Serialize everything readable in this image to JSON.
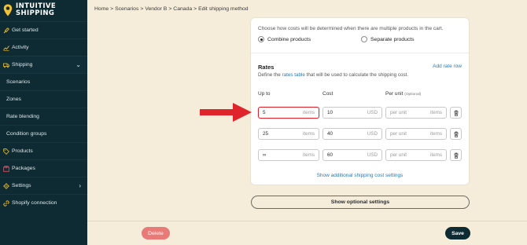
{
  "brand": {
    "line1": "INTUITIVE",
    "line2": "SHIPPING",
    "pin_color": "#f2c230"
  },
  "sidebar": {
    "items": [
      {
        "label": "Get started",
        "icon": "rocket-icon"
      },
      {
        "label": "Activity",
        "icon": "activity-icon"
      },
      {
        "label": "Shipping",
        "icon": "truck-icon",
        "expanded": true
      },
      {
        "label": "Scenarios"
      },
      {
        "label": "Zones"
      },
      {
        "label": "Rate blending"
      },
      {
        "label": "Condition groups"
      },
      {
        "label": "Products",
        "icon": "tag-icon"
      },
      {
        "label": "Packages",
        "icon": "package-icon"
      },
      {
        "label": "Settings",
        "icon": "gear-icon"
      },
      {
        "label": "Shopify connection",
        "icon": "link-icon"
      }
    ]
  },
  "breadcrumb": [
    "Home",
    "Scenarios",
    "Vendor B",
    "Canada",
    "Edit shipping method"
  ],
  "cart": {
    "hint": "Choose how costs will be determined when there are multiple products in the cart.",
    "option_combine": "Combine products",
    "option_separate": "Separate products",
    "selected": "Combine products"
  },
  "rates": {
    "title": "Rates",
    "add_row": "Add rate row",
    "desc_before": "Define the",
    "desc_link": "rates table",
    "desc_after": "that will be used to calculate the shipping cost.",
    "col_upto": "Up to",
    "col_cost": "Cost",
    "col_perunit": "Per unit",
    "col_perunit_note": "(Optional)",
    "rows": [
      {
        "upto": "5",
        "upto_unit": "items",
        "cost": "10",
        "currency": "USD",
        "perunit_placeholder": "per unit",
        "perunit_unit": "items"
      },
      {
        "upto": "25",
        "upto_unit": "items",
        "cost": "40",
        "currency": "USD",
        "perunit_placeholder": "per unit",
        "perunit_unit": "items"
      },
      {
        "upto": "∞",
        "upto_unit": "items",
        "cost": "60",
        "currency": "USD",
        "perunit_placeholder": "per unit",
        "perunit_unit": "items"
      }
    ],
    "show_additional": "Show additional shipping cost settings"
  },
  "buttons": {
    "optional": "Show optional settings",
    "delete": "Delete",
    "save": "Save"
  },
  "colors": {
    "sidebar": "#0e2a33",
    "accent_link": "#2a7ab3",
    "arrow": "#e0242b",
    "delete": "#e87a78",
    "background": "#f5edda"
  }
}
